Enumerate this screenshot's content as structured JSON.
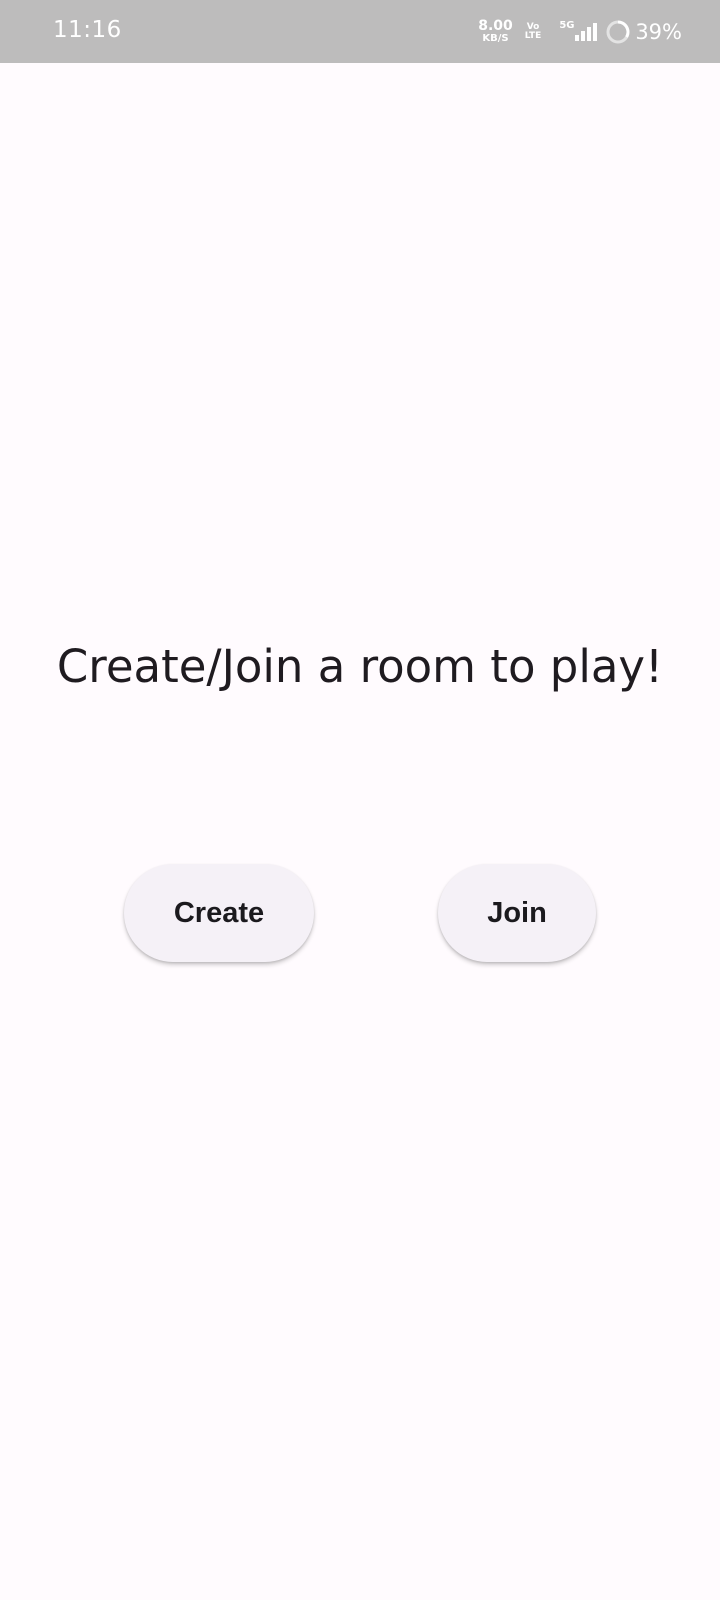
{
  "status_bar": {
    "time": "11:16",
    "net_speed_value": "8.00",
    "net_speed_unit": "KB/S",
    "volte_top": "Vo",
    "volte_bottom": "LTE",
    "network_gen": "5G",
    "battery_percent": "39%",
    "signal_icon": "signal-bars-icon",
    "battery_icon": "battery-ring-icon"
  },
  "main": {
    "title": "Create/Join a room to play!",
    "create_label": "Create",
    "join_label": "Join"
  },
  "colors": {
    "background": "#fffbfe",
    "status_bar": "#bdbcbc",
    "button_bg": "#f5f1f7",
    "text": "#1f1b20"
  }
}
